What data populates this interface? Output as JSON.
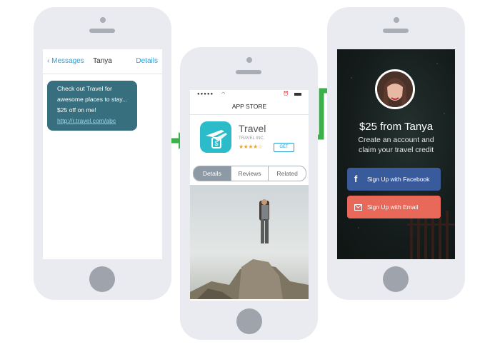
{
  "colors": {
    "accent_blue": "#2a9fd6",
    "bubble": "#386f7e",
    "app_icon": "#2bbbc9",
    "facebook": "#3a5b9b",
    "email": "#e8685a",
    "arrow": "#3bb14a"
  },
  "messages": {
    "back_label": "Messages",
    "contact": "Tanya",
    "details_label": "Details",
    "bubble_lines": [
      "Check out Travel for",
      "awesome places to stay...",
      "$25 off on me!"
    ],
    "bubble_link": "http://r.travel.com/abc"
  },
  "appstore": {
    "title": "APP STORE",
    "app_name": "Travel",
    "developer": "TRAVEL INC.",
    "stars": "★★★★☆",
    "get_label": "GET",
    "tabs": [
      "Details",
      "Reviews",
      "Related"
    ],
    "active_tab": "Details"
  },
  "signup": {
    "headline": "$25 from Tanya",
    "subline_1": "Create an account and",
    "subline_2": "claim your travel credit",
    "facebook_icon": "f",
    "facebook_label": "Sign Up with Facebook",
    "email_icon": "envelope-icon",
    "email_label": "Sign Up with Email"
  }
}
